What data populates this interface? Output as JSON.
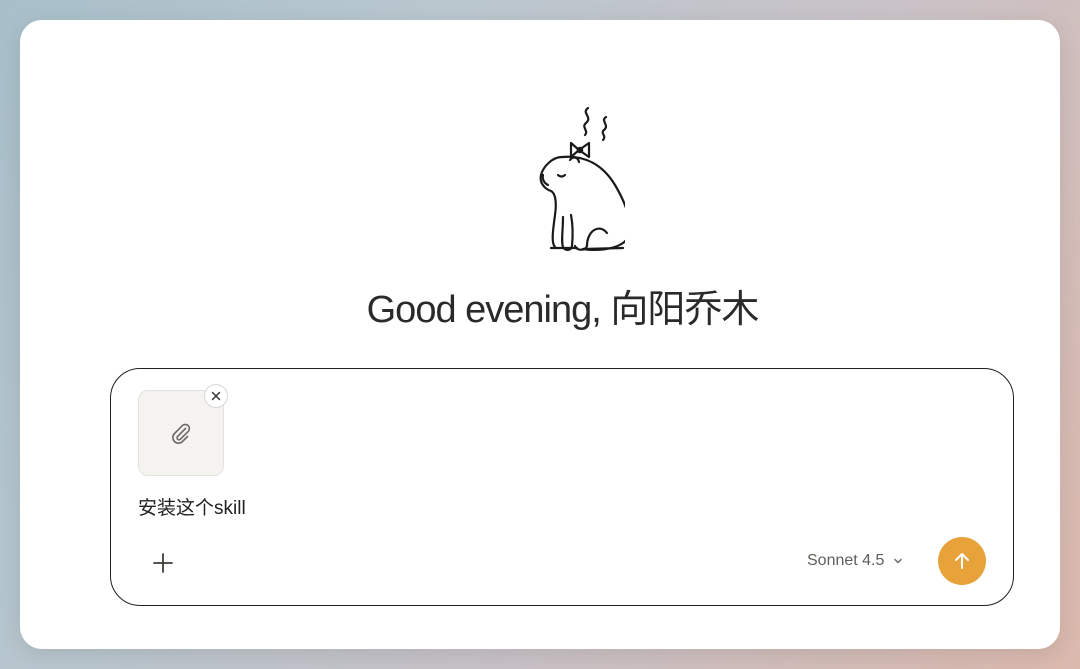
{
  "greeting": "Good evening, 向阳乔木",
  "mascot": {
    "icon": "capybara-with-bow-icon"
  },
  "composer": {
    "attachment": {
      "icon": "paperclip-icon",
      "remove_icon": "close-icon"
    },
    "text": "安装这个skill",
    "add_icon": "plus-icon",
    "model": "Sonnet 4.5",
    "model_icon": "chevron-down-icon",
    "send_icon": "arrow-up-icon"
  },
  "colors": {
    "send_button": "#e8a23a",
    "composer_border": "#1f1f1f",
    "attachment_bg": "#f4f3f0"
  }
}
